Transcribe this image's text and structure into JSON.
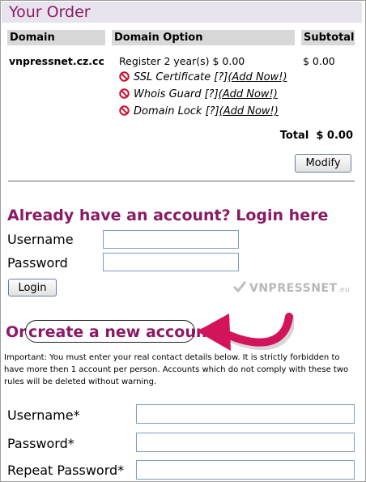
{
  "order": {
    "title": "Your Order",
    "columns": [
      "Domain",
      "Domain Option",
      "Subtotal"
    ],
    "domain": "vnpressnet.cz.cc",
    "option": "Register 2 year(s) $ 0.00",
    "subtotal": "$ 0.00",
    "addons": [
      {
        "name": "SSL Certificate",
        "help": "[?]",
        "link": "(Add Now!)"
      },
      {
        "name": "Whois Guard",
        "help": "[?]",
        "link": "(Add Now!)"
      },
      {
        "name": "Domain Lock",
        "help": "[?]",
        "link": "(Add Now!)"
      }
    ],
    "total_label": "Total",
    "total_value": "$ 0.00",
    "modify_label": "Modify"
  },
  "login": {
    "heading": "Already have an account? Login here",
    "username_label": "Username",
    "password_label": "Password",
    "username_value": "",
    "password_value": "",
    "button_label": "Login"
  },
  "watermark": {
    "text": "VNPRESSNET",
    "suffix": ".eu"
  },
  "register": {
    "heading_prefix": "Or",
    "heading_main": "create a new account",
    "notice": "Important: You must enter your real contact details below. It is strictly forbidden to have more then 1 account per person. Accounts which do not comply with these two rules will be deleted without warning.",
    "username_label": "Username*",
    "password_label": "Password*",
    "repeat_label": "Repeat Password*",
    "username_value": "",
    "password_value": "",
    "repeat_value": ""
  },
  "colors": {
    "heading": "#8b1a66",
    "arrow": "#d4145a",
    "header_bg": "#e8e4ee"
  },
  "icons": {
    "addon_status": "no-entry-icon",
    "arrow": "curved-arrow-icon"
  }
}
